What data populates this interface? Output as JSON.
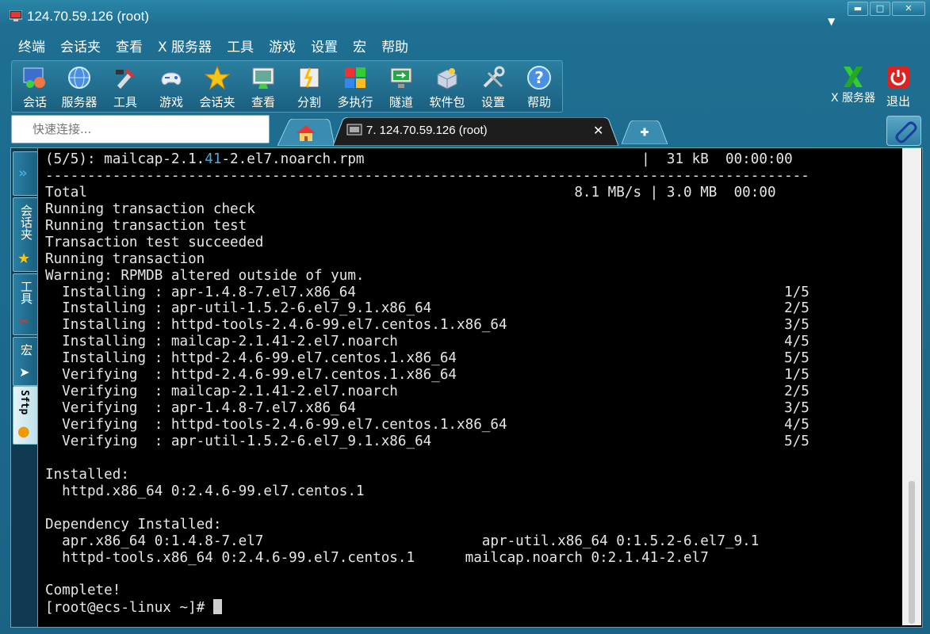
{
  "window": {
    "title": "124.70.59.126 (root)"
  },
  "menu": [
    "终端",
    "会话夹",
    "查看",
    "X 服务器",
    "工具",
    "游戏",
    "设置",
    "宏",
    "帮助"
  ],
  "toolbar": [
    {
      "label": "会话",
      "icon": "session-icon"
    },
    {
      "label": "服务器",
      "icon": "servers-icon"
    },
    {
      "label": "工具",
      "icon": "tools-icon"
    },
    {
      "label": "游戏",
      "icon": "games-icon"
    },
    {
      "label": "会话夹",
      "icon": "star-icon"
    },
    {
      "label": "查看",
      "icon": "view-icon"
    },
    {
      "label": "分割",
      "icon": "split-icon"
    },
    {
      "label": "多执行",
      "icon": "multiexec-icon"
    },
    {
      "label": "隧道",
      "icon": "tunnel-icon"
    },
    {
      "label": "软件包",
      "icon": "packages-icon"
    },
    {
      "label": "设置",
      "icon": "settings-icon"
    },
    {
      "label": "帮助",
      "icon": "help-icon"
    }
  ],
  "right_tools": {
    "xserver_label": "X 服务器",
    "exit_label": "退出"
  },
  "quick_connect": {
    "placeholder": "快速连接..."
  },
  "tabs": {
    "active_label": "7. 124.70.59.126 (root)"
  },
  "sidebar": [
    "会话夹",
    "工具",
    "宏",
    "Sftp"
  ],
  "terminal": {
    "lines": [
      {
        "pre": "(5/5): mailcap-2.1.",
        "hl": "41",
        "post": "-2.el7.noarch.rpm                                 |  31 kB  00:00:00"
      },
      {
        "pre": "-------------------------------------------------------------------------------------------"
      },
      {
        "pre": "Total                                                          8.1 MB/s | 3.0 MB  00:00"
      },
      {
        "pre": "Running transaction check"
      },
      {
        "pre": "Running transaction test"
      },
      {
        "pre": "Transaction test succeeded"
      },
      {
        "pre": "Running transaction"
      },
      {
        "pre": "Warning: RPMDB altered outside of yum."
      },
      {
        "pre": "  Installing : apr-1.4.8-7.el7.x86_64                                                   1/5"
      },
      {
        "pre": "  Installing : apr-util-1.5.2-6.el7_9.1.x86_64                                          2/5"
      },
      {
        "pre": "  Installing : httpd-tools-2.4.6-99.el7.centos.1.x86_64                                 3/5"
      },
      {
        "pre": "  Installing : mailcap-2.1.41-2.el7.noarch                                              4/5"
      },
      {
        "pre": "  Installing : httpd-2.4.6-99.el7.centos.1.x86_64                                       5/5"
      },
      {
        "pre": "  Verifying  : httpd-2.4.6-99.el7.centos.1.x86_64                                       1/5"
      },
      {
        "pre": "  Verifying  : mailcap-2.1.41-2.el7.noarch                                              2/5"
      },
      {
        "pre": "  Verifying  : apr-1.4.8-7.el7.x86_64                                                   3/5"
      },
      {
        "pre": "  Verifying  : httpd-tools-2.4.6-99.el7.centos.1.x86_64                                 4/5"
      },
      {
        "pre": "  Verifying  : apr-util-1.5.2-6.el7_9.1.x86_64                                          5/5"
      },
      {
        "pre": ""
      },
      {
        "pre": "Installed:"
      },
      {
        "pre": "  httpd.x86_64 0:2.4.6-99.el7.centos.1"
      },
      {
        "pre": ""
      },
      {
        "pre": "Dependency Installed:"
      },
      {
        "pre": "  apr.x86_64 0:1.4.8-7.el7                          apr-util.x86_64 0:1.5.2-6.el7_9.1"
      },
      {
        "pre": "  httpd-tools.x86_64 0:2.4.6-99.el7.centos.1      mailcap.noarch 0:2.1.41-2.el7"
      },
      {
        "pre": ""
      },
      {
        "pre": "Complete!"
      }
    ],
    "prompt": "[root@ecs-linux ~]# "
  },
  "colors": {
    "accent": "#1e6f92",
    "terminal_bg": "#000000",
    "terminal_fg": "#e6e6e6",
    "highlight": "#52a8d6"
  }
}
